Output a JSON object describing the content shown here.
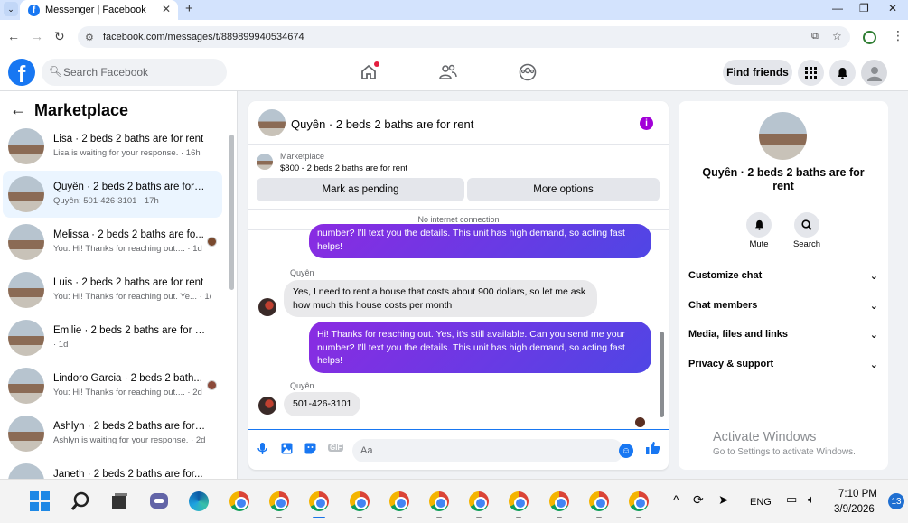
{
  "browser": {
    "tab_title": "Messenger | Facebook",
    "url": "facebook.com/messages/t/889899940534674"
  },
  "header": {
    "search_placeholder": "Search Facebook",
    "find_friends": "Find friends"
  },
  "sidebar": {
    "title": "Marketplace",
    "conversations": [
      {
        "title": "Lisa · 2 beds 2 baths are for rent",
        "sub": "Lisa is waiting for your response. · 16h"
      },
      {
        "title": "Quyên · 2 beds 2 baths are for r...",
        "sub": "Quyên: 501-426-3101 · 17h"
      },
      {
        "title": "Melissa · 2 beds 2 baths are fo...",
        "sub": "You: Hi! Thanks for reaching out.... · 1d"
      },
      {
        "title": "Luis · 2 beds 2 baths are for rent",
        "sub": "You: Hi! Thanks for reaching out. Ye... · 1d"
      },
      {
        "title": "Emilie · 2 beds 2 baths are for rent",
        "sub": "· 1d"
      },
      {
        "title": "Lindoro Garcia · 2 beds 2 bath...",
        "sub": "You: Hi! Thanks for reaching out.... · 2d"
      },
      {
        "title": "Ashlyn · 2 beds 2 baths are for r...",
        "sub": "Ashlyn is waiting for your response. · 2d"
      },
      {
        "title": "Janeth · 2 beds 2 baths are for...",
        "sub": ""
      }
    ]
  },
  "chat": {
    "title": "Quyên · 2 beds 2 baths are for rent",
    "marketplace_label": "Marketplace",
    "listing": "$800 - 2 beds 2 baths are for rent",
    "mark_pending": "Mark as pending",
    "more_options": "More options",
    "no_internet": "No internet connection",
    "messages": [
      {
        "from": "me",
        "text": "number? I'll text you the details. This unit has high demand, so acting fast helps!"
      },
      {
        "from": "Quyên",
        "sender": "Quyên",
        "text": "Yes, I need to rent a house that costs about 900 dollars, so let me ask how much this house costs per month"
      },
      {
        "from": "me",
        "text": "Hi! Thanks for reaching out. Yes, it's still available. Can you send me your number? I'll text you the details. This unit has high demand, so acting fast helps!"
      },
      {
        "from": "Quyên",
        "sender": "Quyên",
        "text": "501-426-3101"
      }
    ],
    "input_placeholder": "Aa"
  },
  "details": {
    "title": "Quyên · 2 beds 2 baths are for rent",
    "mute": "Mute",
    "search": "Search",
    "sections": [
      "Customize chat",
      "Chat members",
      "Media, files and links",
      "Privacy & support"
    ]
  },
  "watermark": {
    "line1": "Activate Windows",
    "line2": "Go to Settings to activate Windows."
  },
  "taskbar": {
    "lang": "ENG",
    "time": "7:10 PM",
    "date": "3/9/2026",
    "notifications": "13"
  },
  "colors": {
    "brand": "#1877f2",
    "outgoing_bubble": "#6a3be6",
    "incoming_bubble": "#e9e9eb"
  }
}
